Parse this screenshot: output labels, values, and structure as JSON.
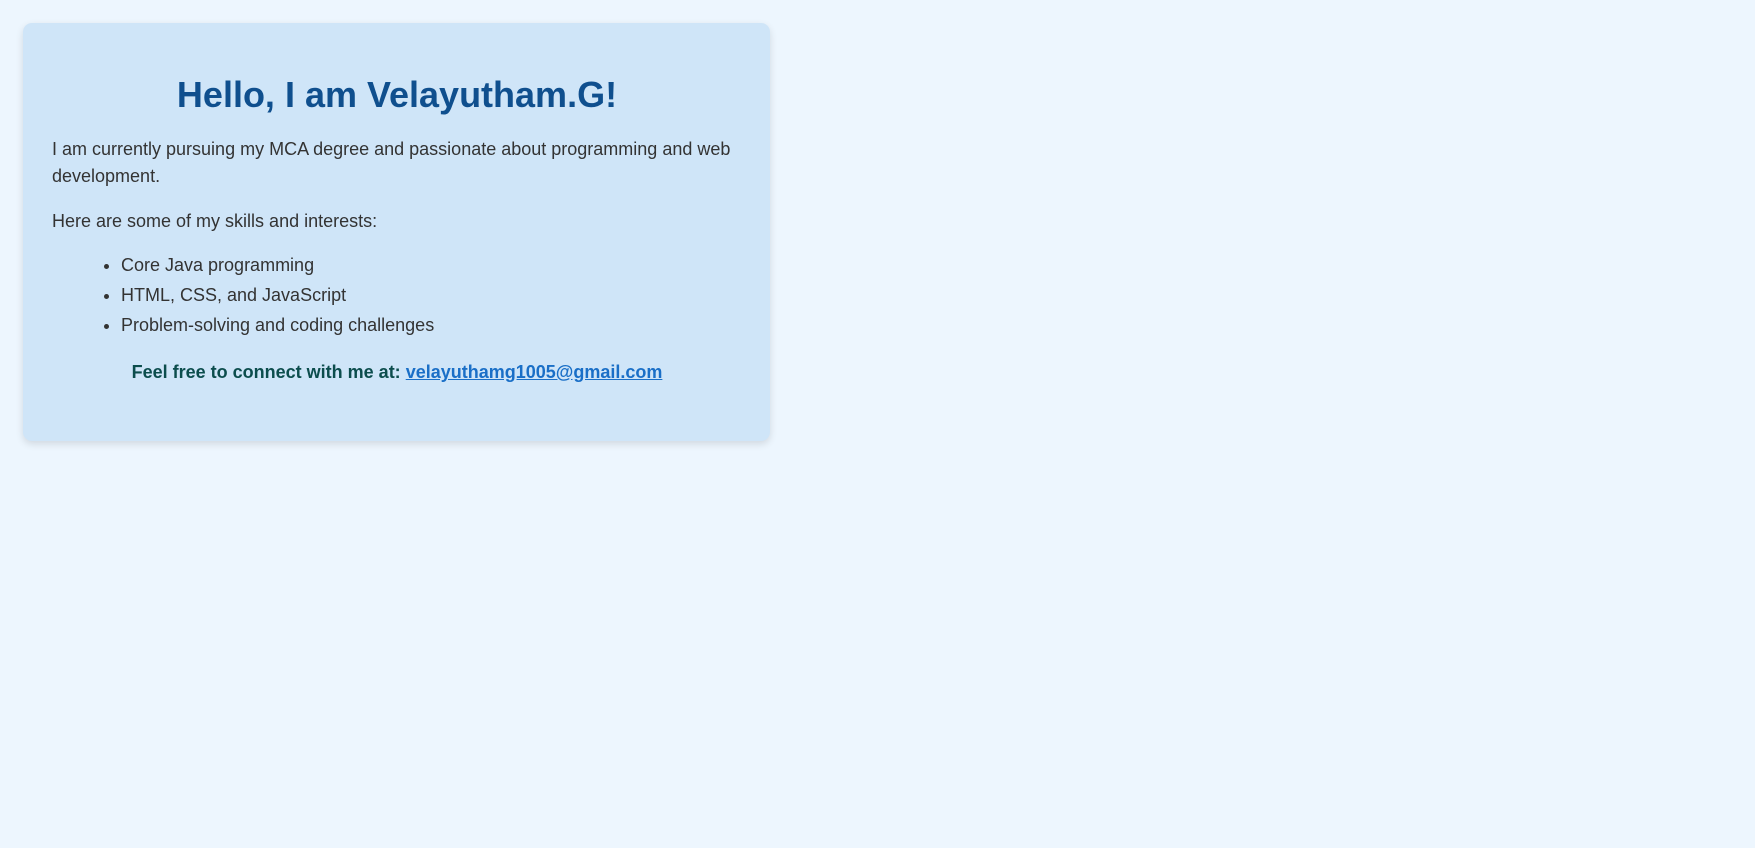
{
  "header": {
    "title": "Hello, I am Velayutham.G!"
  },
  "intro": {
    "text": "I am currently pursuing my MCA degree and passionate about programming and web development."
  },
  "skills": {
    "intro": "Here are some of my skills and interests:",
    "items": [
      "Core Java programming",
      "HTML, CSS, and JavaScript",
      "Problem-solving and coding challenges"
    ]
  },
  "contact": {
    "label": "Feel free to connect with me at:",
    "email": "velayuthamg1005@gmail.com"
  },
  "colors": {
    "page_background": "#edf6fe",
    "card_background": "#cfe5f8",
    "title": "#0f4f8e",
    "body_text": "#333333",
    "contact_text": "#0c4d4d",
    "link": "#1a6fc7"
  }
}
